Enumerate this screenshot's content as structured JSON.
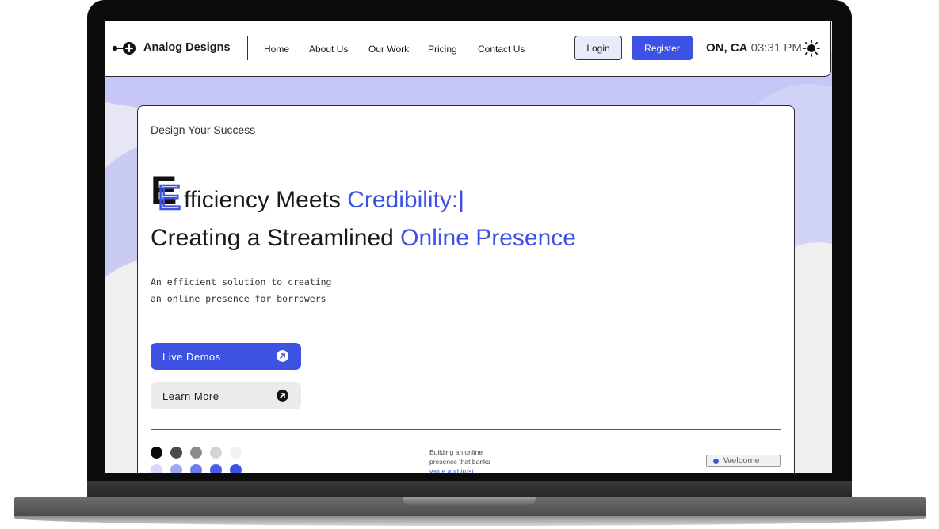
{
  "brand": {
    "name": "Analog Designs",
    "logo_icon": "dot-plus-logo-icon"
  },
  "nav": {
    "links": [
      "Home",
      "About Us",
      "Our Work",
      "Pricing",
      "Contact Us"
    ],
    "login_label": "Login",
    "register_label": "Register",
    "region": "ON, CA",
    "time": "03:31 PM",
    "theme_icon": "sun-icon"
  },
  "hero": {
    "tagline": "Design Your Success",
    "headline_initial": "E",
    "headline_line1_plain": "fficiency Meets ",
    "headline_line1_accent": "Credibility:|",
    "headline_line2_plain": "Creating a Streamlined ",
    "headline_line2_accent": "Online Presence",
    "description_line1": "An efficient solution to creating",
    "description_line2": "an online presence for borrowers",
    "primary_button": "Live Demos",
    "secondary_button": "Learn More"
  },
  "footer_strip": {
    "text_line1": "Building an online",
    "text_line2": "presence that banks",
    "text_line3": "value and trust",
    "welcome_label": "Welcome",
    "palette_row1": [
      "#0a0a0a",
      "#4a4a4a",
      "#8c8c8c",
      "#d4d4d4",
      "#f2f2f2"
    ],
    "palette_row2": [
      "#d6d9f7",
      "#9ea8f0",
      "#6d7de9",
      "#4a5ce5",
      "#3d52e3"
    ]
  },
  "colors": {
    "accent": "#3d52e3",
    "background": "#e6e6f6",
    "frame": "#0b0b0b"
  }
}
